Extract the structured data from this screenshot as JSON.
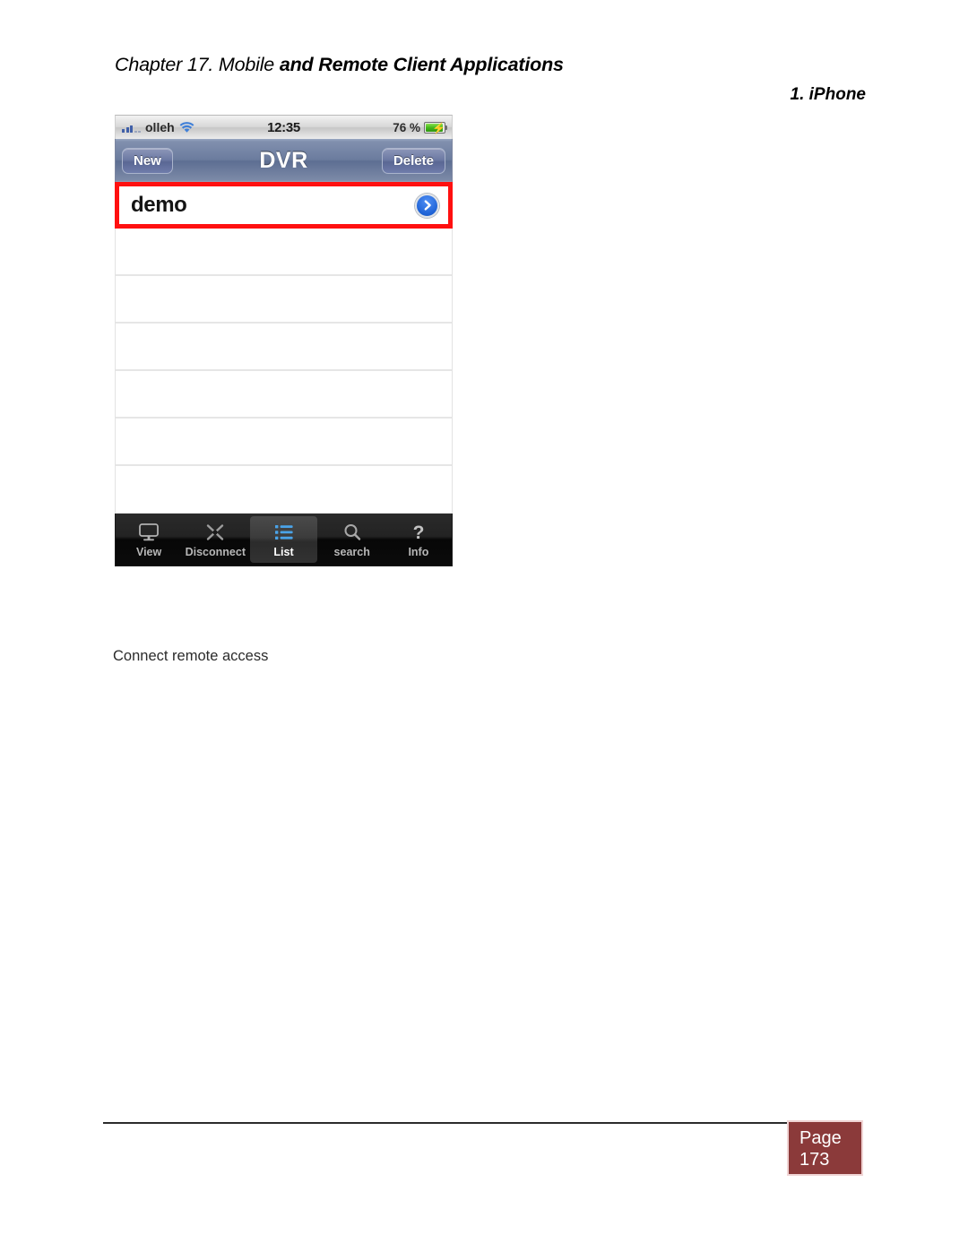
{
  "document": {
    "header": {
      "chapter_prefix": "Chapter 17. Mobile ",
      "chapter_bold": "and Remote Client Applications",
      "section": "1. iPhone"
    },
    "caption": "Connect remote access",
    "footer": {
      "page_label": "Page",
      "page_number": "173"
    }
  },
  "phone": {
    "status_bar": {
      "carrier": "olleh",
      "time": "12:35",
      "battery_percent": "76 %",
      "wifi_icon": "wifi-icon",
      "signal_icon": "signal-bars-icon",
      "battery_icon": "battery-charging-icon"
    },
    "nav_bar": {
      "left_button": "New",
      "title": "DVR",
      "right_button": "Delete"
    },
    "list": {
      "highlighted_item": {
        "label": "demo",
        "accessory_icon": "disclosure-arrow-icon",
        "highlight_color": "#ff1010"
      },
      "empty_rows": 6
    },
    "tab_bar": {
      "items": [
        {
          "label": "View",
          "icon": "monitor-icon",
          "active": false
        },
        {
          "label": "Disconnect",
          "icon": "disconnect-x-icon",
          "active": false
        },
        {
          "label": "List",
          "icon": "list-icon",
          "active": true
        },
        {
          "label": "search",
          "icon": "search-icon",
          "active": false
        },
        {
          "label": "Info",
          "icon": "question-mark-icon",
          "active": false
        }
      ],
      "active_color": "#4aa3e8"
    }
  },
  "colors": {
    "highlight_red": "#ff1010",
    "footer_red": "#8b3a3a",
    "nav_blue": "#6b7c9e",
    "accent_blue": "#1f63d6"
  }
}
